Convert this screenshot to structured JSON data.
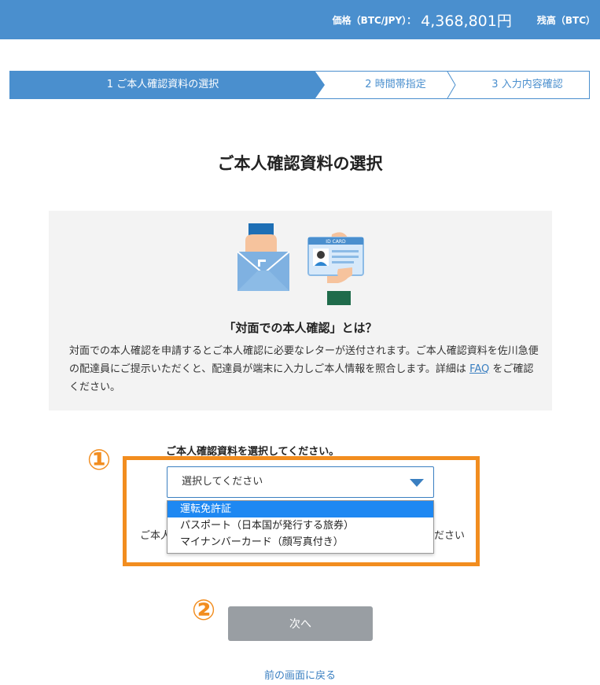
{
  "header": {
    "price_label": "価格（BTC/JPY）：",
    "price_value": "4,368,801円",
    "balance_label": "残高（BTC）"
  },
  "steps": [
    {
      "label": "1 ご本人確認資料の選択",
      "active": true
    },
    {
      "label": "2 時間帯指定",
      "active": false
    },
    {
      "label": "3 入力内容確認",
      "active": false
    }
  ],
  "page": {
    "title": "ご本人確認資料の選択"
  },
  "info": {
    "card_label": "ID CARD",
    "heading": "「対面での本人確認」とは？",
    "body_before": "対面での本人確認を申請するとご本人確認に必要なレターが送付されます。ご本人確認資料を佐川急便の配達員にご提示いただくと、配達員が端末に入力しご本人情報を照合します。詳細は ",
    "faq_link": "FAQ",
    "body_after": " をご確認ください。"
  },
  "annotations": {
    "one": "①",
    "two": "②"
  },
  "form": {
    "select_label": "ご本人確認資料を選択してください。",
    "select_placeholder": "選択してください",
    "behind_left": "ご本人",
    "behind_right": "ださい",
    "options": [
      "運転免許証",
      "パスポート（日本国が発行する旅券）",
      "マイナンバーカード（顔写真付き）"
    ],
    "highlighted_option": 0
  },
  "actions": {
    "next_label": "次へ",
    "back_label": "前の画面に戻る"
  },
  "colors": {
    "brand_blue": "#4a8fce",
    "annotation_orange": "#f28d1f",
    "highlight_blue": "#1e88f2",
    "disabled_gray": "#999ea3"
  }
}
